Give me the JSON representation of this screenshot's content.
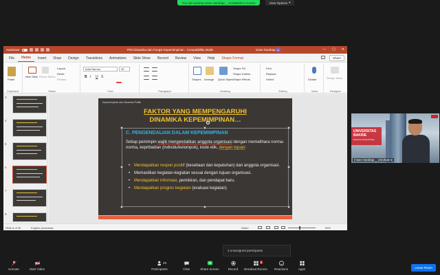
{
  "zoom": {
    "share_banner": "You are viewing Insan Harahap _ UnivBakrie's screen",
    "view_options": "View Options",
    "unassigned": "3 unassigned participants",
    "participants_count": "29",
    "breakout_count": "4",
    "toolbar": {
      "unmute": "Unmute",
      "start_video": "Start Video",
      "participants": "Participants",
      "chat": "Chat",
      "share_screen": "Share Screen",
      "record": "Record",
      "breakout": "Breakout Rooms",
      "reactions": "Reactions",
      "apps": "Apps",
      "leave": "Leave Room"
    },
    "colors": {
      "share_green": "#23d959",
      "leave_blue": "#0e72ed"
    }
  },
  "ppt": {
    "autosave": "AutoSave",
    "doc_title": "P02 Dinamika dan Fungsi Kepemimpinan  -  Compatibility Mode",
    "user_name": "insan harahap",
    "user_initials": "IH",
    "tabs": [
      "File",
      "Home",
      "Insert",
      "Draw",
      "Design",
      "Transitions",
      "Animations",
      "Slide Show",
      "Record",
      "Review",
      "View",
      "Help",
      "Shape Format"
    ],
    "share": "Share",
    "ribbon": {
      "paste": "Paste",
      "clipboard": "Clipboard",
      "new_slide": "New Slide",
      "reuse_slides": "Reuse Slides",
      "layout": "Layout",
      "reset": "Reset",
      "section": "Section",
      "slides": "Slides",
      "font_name": "Arial Narrow",
      "font_size": "26",
      "font": "Font",
      "paragraph": "Paragraph",
      "shapes": "Shapes",
      "arrange": "Arrange",
      "quick_styles": "Quick Styles",
      "shape_fill": "Shape Fill",
      "shape_outline": "Shape Outline",
      "shape_effects": "Shape Effects",
      "drawing": "Drawing",
      "find": "Find",
      "replace": "Replace",
      "select": "Select",
      "editing": "Editing",
      "dictate": "Dictate",
      "voice": "Voice",
      "design_ideas": "Design Ideas",
      "designer": "Designer"
    },
    "thumb_numbers": [
      "3",
      "4",
      "5",
      "6",
      "7",
      "8"
    ],
    "slide": {
      "header": "Kepemimpinan dan Dinamika Politik",
      "title_line1": "FAKTOR YANG MEMPENGARUHI",
      "title_line2": "DINAMIKA KEPEMIMPINAN…",
      "subtitle": "C. PENGENDALIAN DALAM KEPEMIMPINAN",
      "para_a": "Setiap pemimpin ",
      "para_b": "wajib mengendalikan anggota organisasi",
      "para_c": " dengan memelihara norma-norma, kepribadian (individu/kelompok), kode etik, ",
      "para_d": "dengan tujuan",
      "para_e": ":",
      "bullets": [
        {
          "hl": "Mendapatkan respon positif",
          "rest": " (kesetiaan dan kepatuhan) dari anggota organisasi."
        },
        {
          "hl": "",
          "rest": "Memastikan kegiatan-kegiatan sesuai dengan tujuan organisasi."
        },
        {
          "hl": "Mendapatkan informasi",
          "rest": ", pemikiran, dan pendapat baru."
        },
        {
          "hl": "Mendapatkan progres kegiatan",
          "rest": " (evaluasi kegiatan)"
        }
      ]
    },
    "status": {
      "slide_of": "Slide 6 of 26",
      "language": "English (Australia)",
      "notes": "Notes",
      "zoom": "63%"
    }
  },
  "video": {
    "university_line1": "UNIVERSITAS",
    "university_line2": "BAKRIE",
    "tagline": "Experience the Real Things",
    "participant_name": "Insan Harahap _ UnivBakrie"
  }
}
